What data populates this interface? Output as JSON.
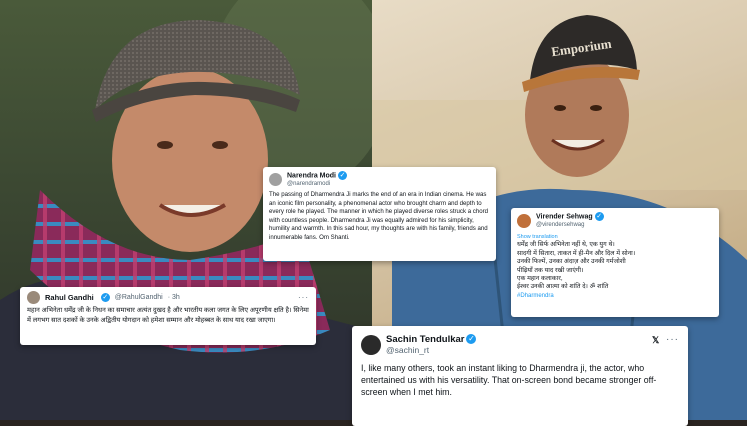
{
  "colors": {
    "verified": "#1d9bf0",
    "text": "#0f1419",
    "muted": "#536471"
  },
  "tweets": {
    "modi": {
      "name": "Narendra Modi",
      "handle": "@narendramodi",
      "text": "The passing of Dharmendra Ji marks the end of an era in Indian cinema. He was an iconic film personality, a phenomenal actor who brought charm and depth to every role he played. The manner in which he played diverse roles struck a chord with countless people. Dharmendra Ji was equally admired for his simplicity, humility and warmth. In this sad hour, my thoughts are with his family, friends and innumerable fans. Om Shanti."
    },
    "sehwag": {
      "name": "Virender Sehwag",
      "handle": "@virendersehwag",
      "translation_label": "Show translation",
      "text": "धर्मेंद्र जी सिर्फ अभिनेता नहीं थे, एक युग थे।\nसादगी में सितारा, ताकत में ही-मैन और दिल में सोना।\nउनकी फिल्में, उनका अंदाज़ और उनकी गर्मजोशी\nपीढ़ियाँ तक याद रखी जाएंगी।\nएक महान कलाकार,\nईश्वर उनकी आत्मा को शांति दे। ॐ शांति",
      "hashtag": "#Dharmendra"
    },
    "gandhi": {
      "name": "Rahul Gandhi",
      "handle": "@RahulGandhi",
      "time": "· 3h",
      "text": "महान अभिनेता धर्मेंद्र जी के निधन का समाचार अत्यंत दुखद है और भारतीय कला जगत के लिए अपूरणीय क्षति है। सिनेमा में लगभग सात दशकों के उनके अद्वितीय योगदान को हमेशा सम्मान और मोहब्बत के साथ याद रखा जाएगा।"
    },
    "tendulkar": {
      "name": "Sachin Tendulkar",
      "handle": "@sachin_rt",
      "text": "I, like many others, took an instant liking to Dharmendra ji, the actor, who entertained us with his versatility. That on-screen bond became stronger off-screen when I met him."
    }
  },
  "cap_text": "Emporium",
  "icons": [
    "verified-icon",
    "more-icon",
    "x-logo-icon"
  ]
}
